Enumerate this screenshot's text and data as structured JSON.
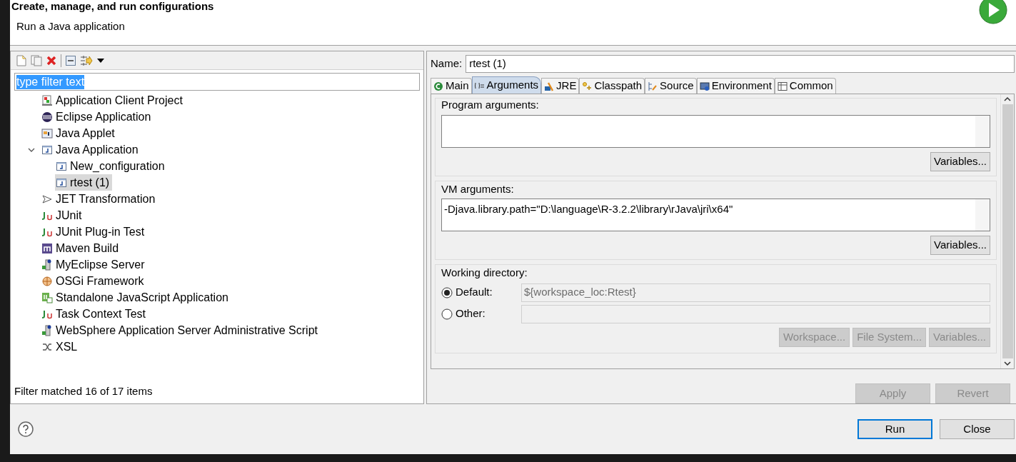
{
  "header": {
    "title": "Create, manage, and run configurations",
    "subtitle": "Run a Java application"
  },
  "left": {
    "filter": {
      "value": "type filter text"
    },
    "tree": [
      {
        "label": "Application Client Project",
        "kind": "client",
        "selected": false
      },
      {
        "label": "Eclipse Application",
        "kind": "eclipse",
        "selected": false
      },
      {
        "label": "Java Applet",
        "kind": "applet",
        "selected": false
      },
      {
        "label": "Java Application",
        "kind": "java",
        "selected": false,
        "expanded": true,
        "children": [
          {
            "label": "New_configuration",
            "kind": "java",
            "selected": false
          },
          {
            "label": "rtest (1)",
            "kind": "java",
            "selected": true
          }
        ]
      },
      {
        "label": "JET Transformation",
        "kind": "jet",
        "selected": false
      },
      {
        "label": "JUnit",
        "kind": "junit",
        "selected": false
      },
      {
        "label": "JUnit Plug-in Test",
        "kind": "junit",
        "selected": false
      },
      {
        "label": "Maven Build",
        "kind": "maven",
        "selected": false
      },
      {
        "label": "MyEclipse Server",
        "kind": "server",
        "selected": false
      },
      {
        "label": "OSGi Framework",
        "kind": "osgi",
        "selected": false
      },
      {
        "label": "Standalone JavaScript Application",
        "kind": "js",
        "selected": false
      },
      {
        "label": "Task Context Test",
        "kind": "junit",
        "selected": false
      },
      {
        "label": "WebSphere Application Server Administrative Script",
        "kind": "server",
        "selected": false
      },
      {
        "label": "XSL",
        "kind": "xsl",
        "selected": false
      }
    ],
    "status": "Filter matched 16 of 17 items"
  },
  "right": {
    "name_label": "Name:",
    "name_value": "rtest (1)",
    "tabs": [
      {
        "label": "Main",
        "selected": false
      },
      {
        "label": "Arguments",
        "selected": true
      },
      {
        "label": "JRE",
        "selected": false
      },
      {
        "label": "Classpath",
        "selected": false
      },
      {
        "label": "Source",
        "selected": false
      },
      {
        "label": "Environment",
        "selected": false
      },
      {
        "label": "Common",
        "selected": false
      }
    ],
    "program_arguments": {
      "label": "Program arguments:",
      "button": "Variables..."
    },
    "vm_arguments": {
      "label": "VM arguments:",
      "value": "-Djava.library.path=\"D:\\language\\R-3.2.2\\library\\rJava\\jri\\x64\"",
      "button": "Variables..."
    },
    "working_directory": {
      "label": "Working directory:",
      "options": [
        {
          "label": "Default:",
          "selected": true,
          "value": "${workspace_loc:Rtest}"
        },
        {
          "label": "Other:",
          "selected": false
        }
      ],
      "buttons": [
        {
          "label": "Workspace...",
          "disabled": true
        },
        {
          "label": "File System...",
          "disabled": true
        },
        {
          "label": "Variables...",
          "disabled": true
        }
      ]
    },
    "actions": [
      {
        "label": "Apply",
        "disabled": true
      },
      {
        "label": "Revert",
        "disabled": true
      }
    ]
  },
  "footer": {
    "buttons": [
      {
        "label": "Run",
        "default": true
      },
      {
        "label": "Close",
        "default": false
      }
    ]
  }
}
